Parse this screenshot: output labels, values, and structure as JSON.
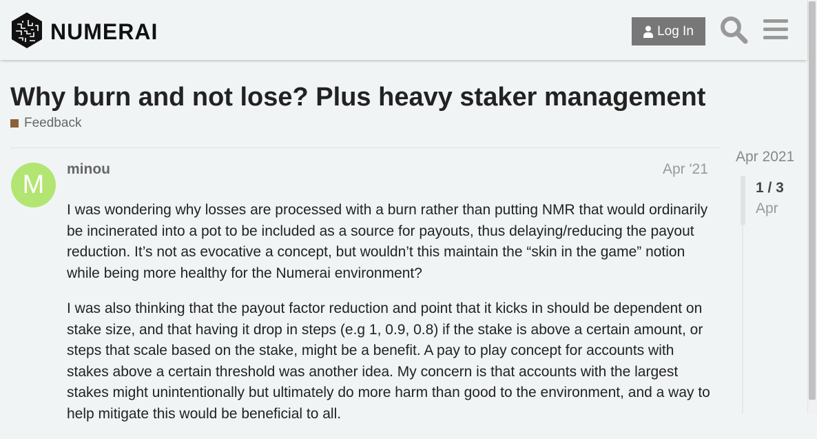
{
  "header": {
    "brand": "NUMERAI",
    "login_label": "Log In",
    "search_icon": "search-icon",
    "menu_icon": "hamburger-menu-icon"
  },
  "topic": {
    "title": "Why burn and not lose? Plus heavy staker management",
    "category": "Feedback",
    "category_color": "#8c6238"
  },
  "post": {
    "avatar_letter": "M",
    "avatar_color": "#b3e572",
    "username": "minou",
    "date": "Apr '21",
    "paragraphs": [
      "I was wondering why losses are processed with a burn rather than putting NMR that would ordinarily be incinerated into a pot to be included as a source for payouts, thus delaying/reducing the payout reduction. It’s not as evocative a concept, but wouldn’t this maintain the “skin in the game” notion while being more healthy for the Numerai environment?",
      "I was also thinking that the payout factor reduction and point that it kicks in should be dependent on stake size, and that having it drop in steps (e.g 1, 0.9, 0.8) if the stake is above a certain amount, or steps that scale based on the stake, might be a benefit. A pay to play concept for accounts with stakes above a certain threshold was another idea. My concern is that accounts with the largest stakes might unintentionally but ultimately do more harm than good to the environment, and a way to help mitigate this would be beneficial to all."
    ]
  },
  "timeline": {
    "start_label": "Apr 2021",
    "position": "1 / 3",
    "month": "Apr"
  }
}
